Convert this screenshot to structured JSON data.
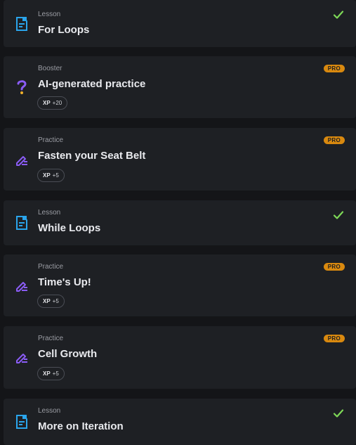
{
  "items": [
    {
      "category": "Lesson",
      "title": "For Loops",
      "kind": "lesson-icon",
      "status": "completed"
    },
    {
      "category": "Booster",
      "title": "AI-generated practice",
      "kind": "question-icon",
      "xp_label": "XP",
      "xp_value": "+20",
      "badge": "PRO"
    },
    {
      "category": "Practice",
      "title": "Fasten your Seat Belt",
      "kind": "practice-icon",
      "xp_label": "XP",
      "xp_value": "+5",
      "badge": "PRO"
    },
    {
      "category": "Lesson",
      "title": "While Loops",
      "kind": "lesson-icon",
      "status": "completed"
    },
    {
      "category": "Practice",
      "title": "Time's Up!",
      "kind": "practice-icon",
      "xp_label": "XP",
      "xp_value": "+5",
      "badge": "PRO"
    },
    {
      "category": "Practice",
      "title": "Cell Growth",
      "kind": "practice-icon",
      "xp_label": "XP",
      "xp_value": "+5",
      "badge": "PRO"
    },
    {
      "category": "Lesson",
      "title": "More on Iteration",
      "kind": "lesson-icon",
      "status": "completed"
    }
  ],
  "colors": {
    "lesson_icon": "#2aa5ec",
    "practice_icon": "#8a5cf5",
    "check": "#7ed957",
    "pro_badge": "#d9890f"
  }
}
